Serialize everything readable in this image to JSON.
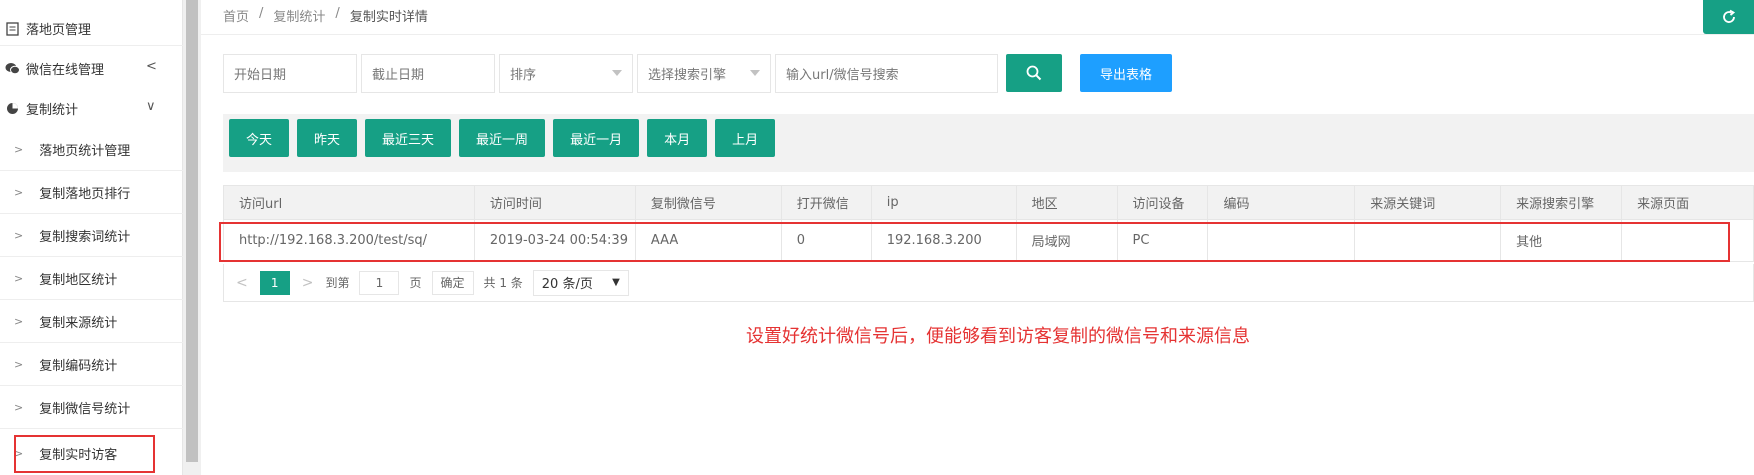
{
  "sidebar": {
    "top_item": "落地页管理",
    "groups": [
      {
        "label": "微信在线管理",
        "arrow": "<"
      },
      {
        "label": "复制统计",
        "arrow": "∨"
      }
    ],
    "sub_items": [
      "落地页统计管理",
      "复制落地页排行",
      "复制搜索词统计",
      "复制地区统计",
      "复制来源统计",
      "复制编码统计",
      "复制微信号统计",
      "复制实时访客"
    ],
    "chevron": ">"
  },
  "breadcrumb": {
    "items": [
      "首页",
      "复制统计",
      "复制实时详情"
    ],
    "separator": "/"
  },
  "filters": {
    "start_date": "开始日期",
    "end_date": "截止日期",
    "sort": "排序",
    "engine": "选择搜索引擎",
    "keyword": "输入url/微信号搜索",
    "export": "导出表格"
  },
  "quick_buttons": [
    "今天",
    "昨天",
    "最近三天",
    "最近一周",
    "最近一月",
    "本月",
    "上月"
  ],
  "table": {
    "headers": [
      "访问url",
      "访问时间",
      "复制微信号",
      "打开微信",
      "ip",
      "地区",
      "访问设备",
      "编码",
      "来源关键词",
      "来源搜索引擎",
      "来源页面"
    ],
    "rows": [
      [
        "http://192.168.3.200/test/sq/",
        "2019-03-24 00:54:39",
        "AAA",
        "0",
        "192.168.3.200",
        "局域网",
        "PC",
        "",
        "",
        "其他",
        ""
      ]
    ]
  },
  "pager": {
    "prev": "<",
    "current": "1",
    "next": ">",
    "goto_label": "到第",
    "goto_value": "1",
    "page_unit": "页",
    "confirm": "确定",
    "total": "共 1 条",
    "page_size": "20 条/页"
  },
  "annotation": "设置好统计微信号后，便能够看到访客复制的微信号和来源信息",
  "colors": {
    "accent": "#16a085",
    "export": "#1e9fff",
    "highlight": "#e53333"
  }
}
